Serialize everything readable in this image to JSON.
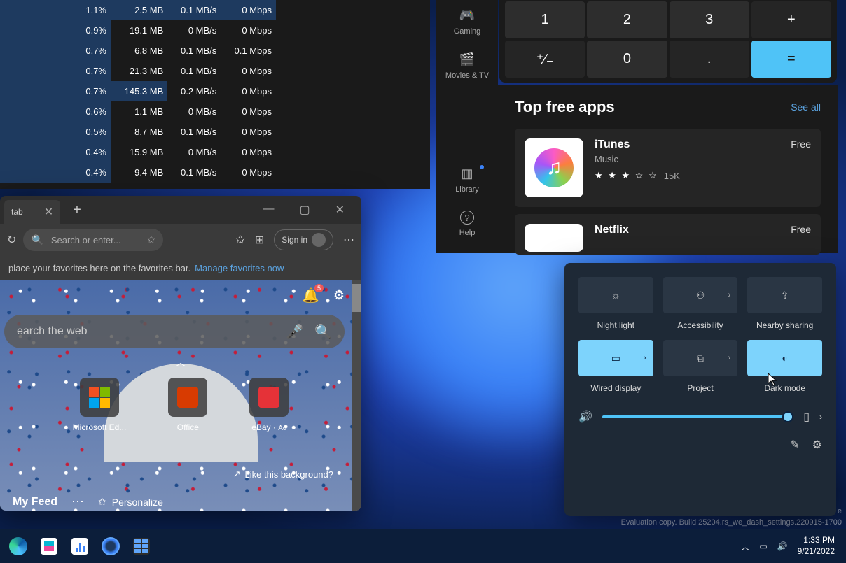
{
  "taskmgr": {
    "rows": [
      {
        "cpu": "1.1%",
        "mem": "2.5 MB",
        "disk": "0.1 MB/s",
        "net": "0 Mbps",
        "hl": true
      },
      {
        "cpu": "0.9%",
        "mem": "19.1 MB",
        "disk": "0 MB/s",
        "net": "0 Mbps"
      },
      {
        "cpu": "0.7%",
        "mem": "6.8 MB",
        "disk": "0.1 MB/s",
        "net": "0.1 Mbps"
      },
      {
        "cpu": "0.7%",
        "mem": "21.3 MB",
        "disk": "0.1 MB/s",
        "net": "0 Mbps"
      },
      {
        "cpu": "0.7%",
        "mem": "145.3 MB",
        "disk": "0.2 MB/s",
        "net": "0 Mbps",
        "hlmem": true
      },
      {
        "cpu": "0.6%",
        "mem": "1.1 MB",
        "disk": "0 MB/s",
        "net": "0 Mbps"
      },
      {
        "cpu": "0.5%",
        "mem": "8.7 MB",
        "disk": "0.1 MB/s",
        "net": "0 Mbps"
      },
      {
        "cpu": "0.4%",
        "mem": "15.9 MB",
        "disk": "0 MB/s",
        "net": "0 Mbps"
      },
      {
        "cpu": "0.4%",
        "mem": "9.4 MB",
        "disk": "0.1 MB/s",
        "net": "0 Mbps"
      }
    ]
  },
  "edge": {
    "tab_title": "tab",
    "search_placeholder": "Search or enter...",
    "signin": "Sign in",
    "favbar_text": "place your favorites here on the favorites bar.",
    "favbar_link": "Manage favorites now",
    "bigsearch_placeholder": "earch the web",
    "notif_count": "5",
    "tile1": "Microsoft Ed...",
    "tile2": "Office",
    "tile3": "eBay",
    "tile3_sub": "Ad",
    "likebg": "Like this background?",
    "feed": "My Feed",
    "personalize": "Personalize"
  },
  "store_side": {
    "gaming": "Gaming",
    "movies": "Movies & TV",
    "library": "Library",
    "help": "Help"
  },
  "calc": {
    "r1": [
      "1",
      "2",
      "3",
      "+"
    ],
    "r2": [
      "⁺∕₋",
      "0",
      ".",
      "="
    ]
  },
  "store": {
    "title": "Top free apps",
    "see_all": "See all",
    "app1": {
      "name": "iTunes",
      "cat": "Music",
      "stars": "★ ★ ★ ☆ ☆",
      "count": "15K",
      "price": "Free"
    },
    "app2": {
      "name": "Netflix",
      "price": "Free"
    }
  },
  "qs": {
    "night_light": "Night light",
    "accessibility": "Accessibility",
    "nearby": "Nearby sharing",
    "wired": "Wired display",
    "project": "Project",
    "dark": "Dark mode"
  },
  "watermark": {
    "l1": "e",
    "l2": "Evaluation copy. Build 25204.rs_we_dash_settings.220915-1700"
  },
  "taskbar": {
    "time": "1:33 PM",
    "date": "9/21/2022"
  }
}
